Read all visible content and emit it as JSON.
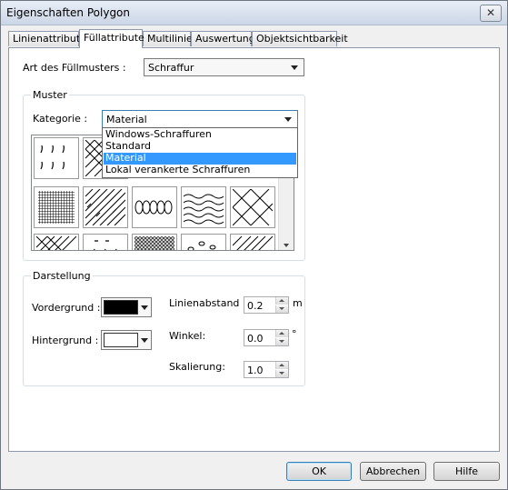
{
  "window": {
    "title": "Eigenschaften Polygon",
    "close_symbol": "✕"
  },
  "tabs": [
    {
      "label": "Linienattribute"
    },
    {
      "label": "Füllattribute"
    },
    {
      "label": "Multilinie"
    },
    {
      "label": "Auswertung"
    },
    {
      "label": "Objektsichtbarkeit"
    }
  ],
  "fill": {
    "label": "Art des Füllmusters :",
    "value": "Schraffur"
  },
  "muster": {
    "group_title": "Muster",
    "category_label": "Kategorie :",
    "category_value": "Material",
    "dropdown_options": [
      "Windows-Schraffuren",
      "Standard",
      "Material",
      "Lokal verankerte Schraffuren"
    ],
    "selected_option": "Material"
  },
  "darstellung": {
    "group_title": "Darstellung",
    "foreground_label": "Vordergrund :",
    "foreground_color": "#000000",
    "background_label": "Hintergrund :",
    "background_color": "#ffffff",
    "spacing_label": "Linienabstand :",
    "spacing_value": "0.2",
    "spacing_unit": "m",
    "angle_label": "Winkel:",
    "angle_value": "0.0",
    "angle_unit": "°",
    "scale_label": "Skalierung:",
    "scale_value": "1.0"
  },
  "buttons": {
    "ok": "OK",
    "cancel": "Abbrechen",
    "help": "Hilfe"
  }
}
